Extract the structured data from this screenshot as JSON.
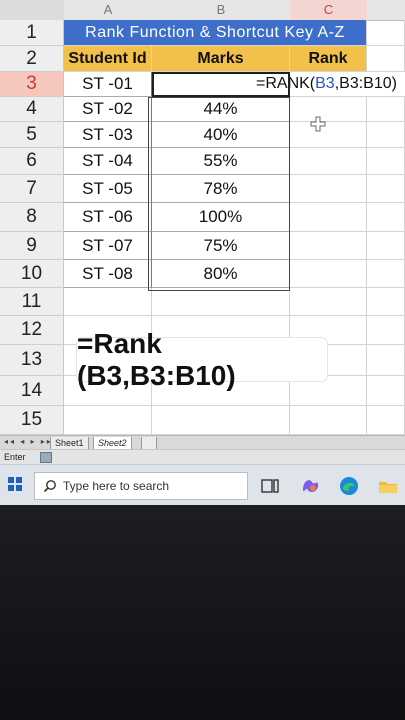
{
  "columns": [
    {
      "letter": "A"
    },
    {
      "letter": "B"
    },
    {
      "letter": "C"
    }
  ],
  "rows": [
    "1",
    "2",
    "3",
    "4",
    "5",
    "6",
    "7",
    "8",
    "9",
    "10",
    "11",
    "12",
    "13",
    "14",
    "15"
  ],
  "title": "Rank Function & Shortcut Key A-Z",
  "headers": {
    "a": "Student Id",
    "b": "Marks",
    "c": "Rank"
  },
  "data": [
    {
      "id": "ST -01",
      "marks": ""
    },
    {
      "id": "ST -02",
      "marks": "44%"
    },
    {
      "id": "ST -03",
      "marks": "40%"
    },
    {
      "id": "ST -04",
      "marks": "55%"
    },
    {
      "id": "ST -05",
      "marks": "78%"
    },
    {
      "id": "ST -06",
      "marks": "100%"
    },
    {
      "id": "ST -07",
      "marks": "75%"
    },
    {
      "id": "ST -08",
      "marks": "80%"
    }
  ],
  "formula": {
    "prefix": "=RANK(",
    "ref": "B3",
    "suffix": ",B3:B10)"
  },
  "sheet_tabs": [
    "Sheet1",
    "Sheet2"
  ],
  "status_mode": "Enter",
  "taskbar": {
    "search_placeholder": "Type here to search"
  },
  "overlay_text": "=Rank (B3,B3:B10)",
  "colors": {
    "title_bg": "#3d6ec9",
    "header_bg": "#f2c14b",
    "selected_row": "#f6c7bd",
    "ref_color": "#2b55c8"
  }
}
